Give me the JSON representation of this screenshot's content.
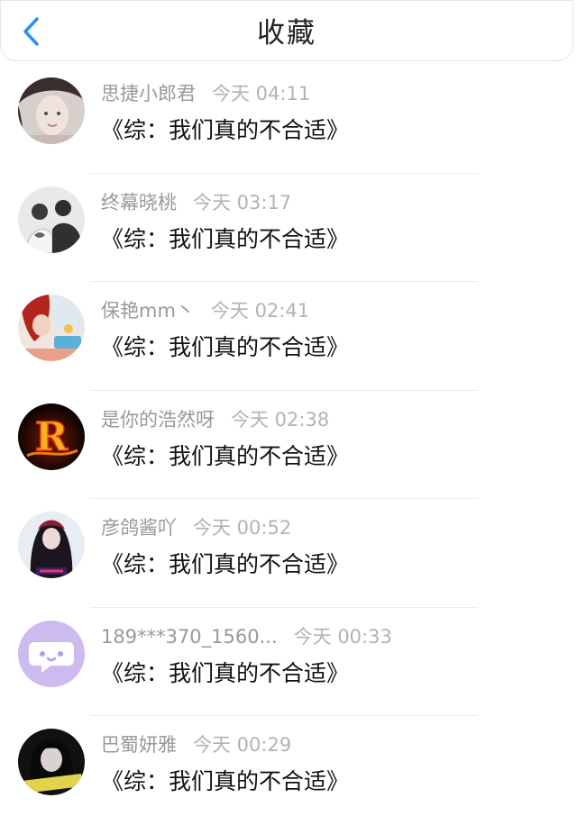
{
  "header": {
    "title": "收藏",
    "back_icon": "chevron-left-icon",
    "accent_color": "#2f8ff0"
  },
  "items": [
    {
      "name": "思捷小郎君",
      "time": "今天 04:11",
      "content": "《综：我们真的不合适》"
    },
    {
      "name": "终幕晓桃",
      "time": "今天 03:17",
      "content": "《综：我们真的不合适》"
    },
    {
      "name": "保艳mm丶",
      "time": "今天 02:41",
      "content": "《综：我们真的不合适》"
    },
    {
      "name": "是你的浩然呀",
      "time": "今天 02:38",
      "content": "《综：我们真的不合适》",
      "avatar_text": "R"
    },
    {
      "name": "彦鸽酱吖",
      "time": "今天 00:52",
      "content": "《综：我们真的不合适》"
    },
    {
      "name": "189***370_1560...",
      "time": "今天 00:33",
      "content": "《综：我们真的不合适》"
    },
    {
      "name": "巴蜀妍雅",
      "time": "今天 00:29",
      "content": "《综：我们真的不合适》"
    }
  ]
}
